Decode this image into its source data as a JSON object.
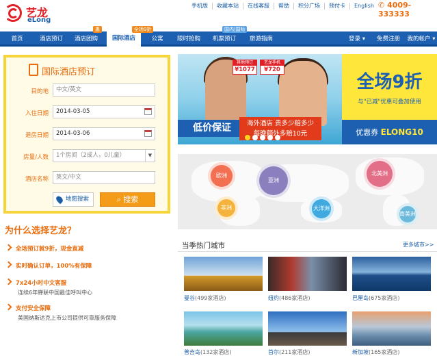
{
  "brand": {
    "name_cn": "艺龙",
    "name_en": "eLong"
  },
  "top_links": [
    "手机版",
    "收藏本站",
    "在线客服",
    "帮助",
    "积分广场",
    "预付卡",
    "English"
  ],
  "phone": "4009-333333",
  "nav": {
    "items": [
      "首页",
      "酒店预订",
      "酒店团购",
      "国际酒店",
      "公寓",
      "限时抢购",
      "机票预订",
      "旅游指南"
    ],
    "tags": {
      "group_buy": "惠",
      "intl": "全场9折",
      "flight": "国内|国际"
    },
    "right": [
      "登录",
      "免费注册",
      "我的帐户"
    ]
  },
  "search": {
    "title": "国际酒店预订",
    "destination_label": "目的地",
    "destination_placeholder": "中文/英文",
    "checkin_label": "入住日期",
    "checkin_value": "2014-03-05",
    "checkout_label": "退房日期",
    "checkout_value": "2014-03-06",
    "rooms_label": "房量/人数",
    "rooms_value": "1个房间（2成人，0儿童）",
    "hotel_label": "酒店名称",
    "hotel_placeholder": "英文/中文",
    "map_button": "地图搜索",
    "search_button": "搜索"
  },
  "why": {
    "title": "为什么选择艺龙？",
    "items": [
      {
        "head": "全场预订就9折，现金直减",
        "sub": ""
      },
      {
        "head": "实时确认订单，100%有保障",
        "sub": ""
      },
      {
        "head": "7x24小时中文客服",
        "sub": "连续6年蝉联中国最佳呼叫中心"
      },
      {
        "head": "支付安全保障",
        "sub": "美国纳斯达克上市公司提供可靠服务保障"
      }
    ]
  },
  "banner": {
    "price1_tag": "其他预订",
    "price1": "¥1077",
    "price2_tag": "艺龙手机",
    "price2": "¥720",
    "low_price": "低价保证",
    "hot_line1": "海外酒店 贵多少赔多少",
    "hot_line2": "每晚额外多赔10元",
    "big": "全场9折",
    "sub": "与\"已减\"优惠可叠加使用",
    "coupon_label": "优惠券",
    "coupon_code": "ELONG10"
  },
  "map_regions": [
    "欧洲",
    "亚洲",
    "北美洲",
    "非洲",
    "大洋洲",
    "南美洲"
  ],
  "hot_cities": {
    "title": "当季热门城市",
    "more": "更多城市>>",
    "items": [
      {
        "name": "曼谷",
        "count": "(499家酒店)"
      },
      {
        "name": "纽约",
        "count": "(486家酒店)"
      },
      {
        "name": "巴厘岛",
        "count": "(675家酒店)"
      },
      {
        "name": "普吉岛",
        "count": "(132家酒店)"
      },
      {
        "name": "首尔",
        "count": "(211家酒店)"
      },
      {
        "name": "新加坡",
        "count": "(165家酒店)"
      }
    ]
  },
  "colors": {
    "brand_red": "#e01f26",
    "nav_blue": "#1d60b2",
    "accent_orange": "#e86d0e",
    "banner_yellow": "#ffe63b"
  }
}
